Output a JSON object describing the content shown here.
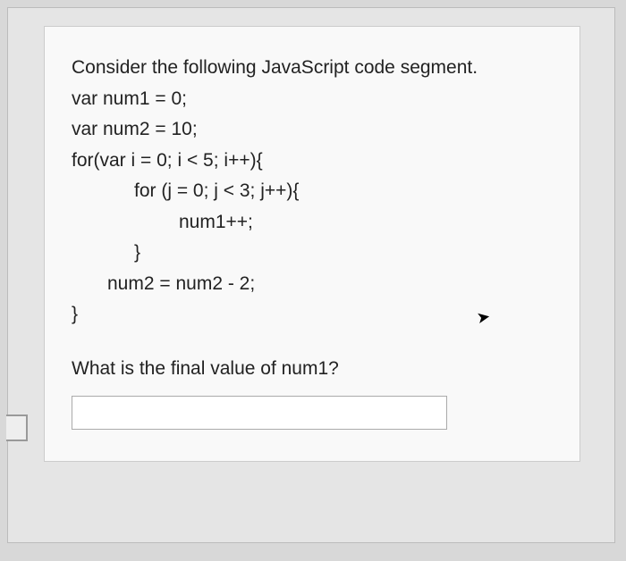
{
  "intro": "Consider the following JavaScript code segment.",
  "code": {
    "l1": "var num1 = 0;",
    "l2": "var num2 = 10;",
    "l3": "for(var i = 0; i < 5; i++){",
    "l4": "for (j = 0; j < 3; j++){",
    "l5": "num1++;",
    "l6": "}",
    "l7": "num2 = num2 - 2;",
    "l8": "}"
  },
  "question": "What is the final value of num1?",
  "answer_value": ""
}
